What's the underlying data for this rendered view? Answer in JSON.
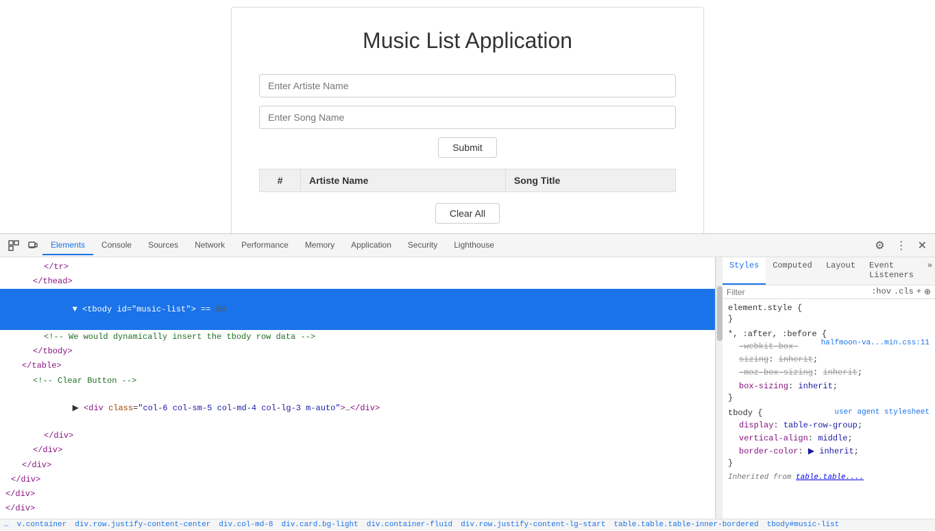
{
  "app": {
    "title": "Music List Application",
    "artiste_placeholder": "Enter Artiste Name",
    "song_placeholder": "Enter Song Name",
    "submit_label": "Submit",
    "clear_label": "Clear All",
    "table": {
      "columns": [
        "#",
        "Artiste Name",
        "Song Title"
      ]
    }
  },
  "devtools": {
    "tabs": [
      {
        "label": "Elements",
        "active": true
      },
      {
        "label": "Console",
        "active": false
      },
      {
        "label": "Sources",
        "active": false
      },
      {
        "label": "Network",
        "active": false
      },
      {
        "label": "Performance",
        "active": false
      },
      {
        "label": "Memory",
        "active": false
      },
      {
        "label": "Application",
        "active": false
      },
      {
        "label": "Security",
        "active": false
      },
      {
        "label": "Lighthouse",
        "active": false
      }
    ],
    "code_lines": [
      {
        "indent": 4,
        "text": "</tr>"
      },
      {
        "indent": 3,
        "text": "</thead>"
      },
      {
        "indent": 3,
        "text": "<tbody id=\"music-list\"> == $0",
        "highlighted": true
      },
      {
        "indent": 4,
        "text": "<!-- We would dynamically insert the tbody row data -->"
      },
      {
        "indent": 3,
        "text": "</tbody>"
      },
      {
        "indent": 2,
        "text": "</table>"
      },
      {
        "indent": 3,
        "text": "<!-- Clear Button -->"
      },
      {
        "indent": 3,
        "text": "<div class=\"col-6 col-sm-5 col-md-4 col-lg-3 m-auto\">…</div>"
      },
      {
        "indent": 4,
        "text": "</div>"
      },
      {
        "indent": 3,
        "text": "</div>"
      },
      {
        "indent": 2,
        "text": "</div>"
      },
      {
        "indent": 1,
        "text": "</div>"
      },
      {
        "indent": 0,
        "text": "</div>"
      },
      {
        "indent": 0,
        "text": "</div>"
      }
    ],
    "styles": {
      "tabs": [
        "Styles",
        "Computed",
        "Layout",
        "Event Listeners",
        "»"
      ],
      "filter_placeholder": "Filter",
      "filter_actions": [
        ":hov",
        ".cls",
        "+",
        "⊕"
      ],
      "rules": [
        {
          "selector": "element.style {",
          "props": [],
          "close": "}"
        },
        {
          "selector": "*, :after, :before {",
          "source": "halfmoon-va...min.css:11",
          "props": [
            {
              "name": "-webkit-box-sizing",
              "value": "inherit",
              "strikethrough": true
            },
            {
              "name": "-moz-box-sizing",
              "value": "inherit",
              "strikethrough": true
            },
            {
              "name": "box-sizing",
              "value": "inherit",
              "strikethrough": false
            }
          ],
          "close": "}"
        },
        {
          "selector": "tbody {",
          "source": "user agent stylesheet",
          "props": [
            {
              "name": "display",
              "value": "table-row-group",
              "strikethrough": false
            },
            {
              "name": "vertical-align",
              "value": "middle",
              "strikethrough": false
            },
            {
              "name": "border-color",
              "value": "▶ inherit",
              "strikethrough": false
            }
          ],
          "close": "}"
        },
        {
          "inherited_label": "Inherited from table.table....",
          "selector": ""
        }
      ]
    },
    "breadcrumb": [
      "…",
      "v.container",
      "div.row.justify-content-center",
      "div.col-md-8",
      "div.card.bg-light",
      "div.container-fluid",
      "div.row.justify-content-lg-start",
      "table.table.table-inner-bordered",
      "tbody#music-list"
    ]
  }
}
